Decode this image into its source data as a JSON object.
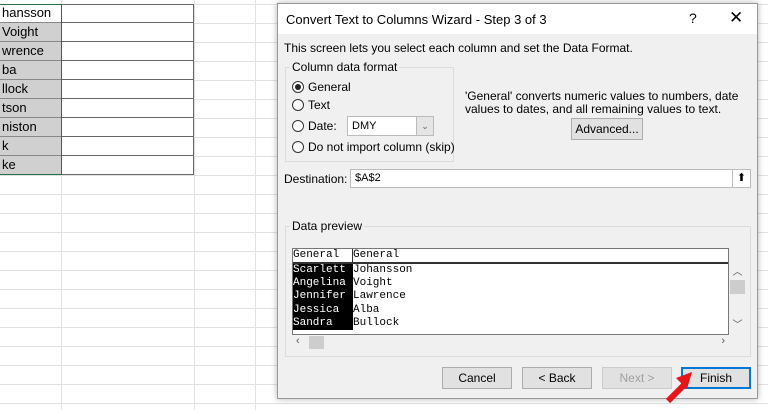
{
  "sheet": {
    "column_a": [
      "hansson",
      "Voight",
      "wrence",
      "ba",
      "llock",
      "tson",
      "niston",
      "k",
      "ke"
    ]
  },
  "dialog": {
    "title": "Convert Text to Columns Wizard - Step 3 of 3",
    "help": "?",
    "close": "✕",
    "intro": "This screen lets you select each column and set the Data Format.",
    "format_group": "Column data format",
    "options": [
      {
        "label": "General",
        "selected": true
      },
      {
        "label": "Text",
        "selected": false
      },
      {
        "label": "Date:",
        "selected": false
      },
      {
        "label": "Do not import column (skip)",
        "selected": false
      }
    ],
    "date_value": "DMY",
    "description": "'General' converts numeric values to numbers, date values to dates, and all remaining values to text.",
    "advanced": "Advanced...",
    "destination_label": "Destination:",
    "destination_value": "$A$2",
    "preview_label": "Data preview",
    "preview_headers": [
      "General",
      "General"
    ],
    "preview_rows": [
      [
        "Scarlett",
        "Johansson"
      ],
      [
        "Angelina",
        "Voight"
      ],
      [
        "Jennifer",
        "Lawrence"
      ],
      [
        "Jessica",
        "Alba"
      ],
      [
        "Sandra",
        "Bullock"
      ]
    ],
    "buttons": {
      "cancel": "Cancel",
      "back": "< Back",
      "next": "Next >",
      "finish": "Finish"
    }
  },
  "colors": {
    "accent": "#0078d7",
    "arrow": "#e8141b",
    "selection": "#217346"
  }
}
